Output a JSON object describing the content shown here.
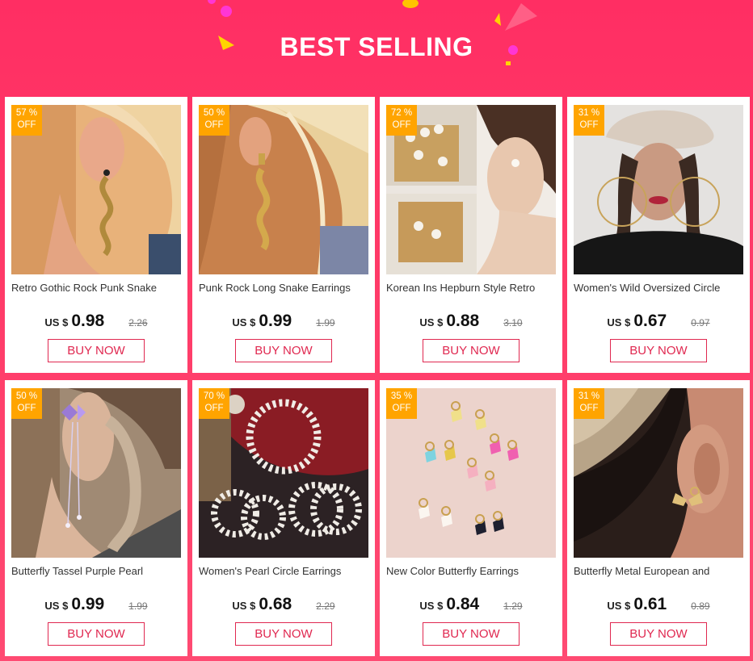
{
  "header": {
    "title": "BEST SELLING"
  },
  "button_label": "BUY NOW",
  "products": [
    {
      "discount_pct": "57 %",
      "discount_off": "OFF",
      "name": "Retro Gothic Rock Punk Snake",
      "currency": "US $",
      "price": "0.98",
      "old_price": "2.26",
      "image": "snake-earring-blonde"
    },
    {
      "discount_pct": "50 %",
      "discount_off": "OFF",
      "name": "Punk Rock Long Snake Earrings",
      "currency": "US $",
      "price": "0.99",
      "old_price": "1.99",
      "image": "gold-snake-earring"
    },
    {
      "discount_pct": "72 %",
      "discount_off": "OFF",
      "name": "Korean Ins Hepburn Style Retro",
      "currency": "US $",
      "price": "0.88",
      "old_price": "3.10",
      "image": "pearl-stud-earrings"
    },
    {
      "discount_pct": "31 %",
      "discount_off": "OFF",
      "name": "Women's Wild Oversized Circle",
      "currency": "US $",
      "price": "0.67",
      "old_price": "0.97",
      "image": "woman-cap-hoops"
    },
    {
      "discount_pct": "50 %",
      "discount_off": "OFF",
      "name": "Butterfly Tassel Purple Pearl",
      "currency": "US $",
      "price": "0.99",
      "old_price": "1.99",
      "image": "purple-butterfly-tassel"
    },
    {
      "discount_pct": "70 %",
      "discount_off": "OFF",
      "name": "Women's Pearl Circle Earrings",
      "currency": "US $",
      "price": "0.68",
      "old_price": "2.29",
      "image": "pearl-hoops-on-red"
    },
    {
      "discount_pct": "35 %",
      "discount_off": "OFF",
      "name": "New Color Butterfly Earrings",
      "currency": "US $",
      "price": "0.84",
      "old_price": "1.29",
      "image": "color-butterfly-earrings"
    },
    {
      "discount_pct": "31 %",
      "discount_off": "OFF",
      "name": "Butterfly Metal European and",
      "currency": "US $",
      "price": "0.61",
      "old_price": "0.89",
      "image": "butterfly-metal-earring"
    }
  ],
  "colors": {
    "background": "#ff2e63",
    "badge": "#ffa400",
    "button": "#e02850"
  }
}
